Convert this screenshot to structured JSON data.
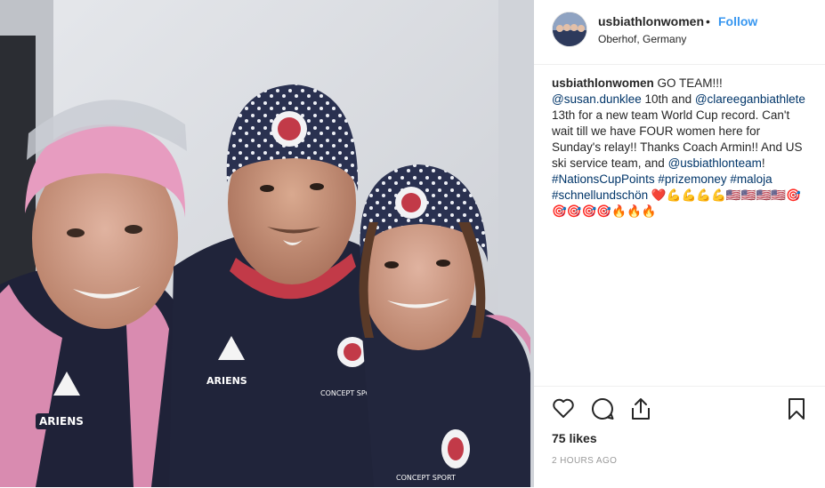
{
  "post": {
    "username": "usbiathlonwomen",
    "separator": "•",
    "follow_label": "Follow",
    "location": "Oberhof, Germany",
    "caption": {
      "username": "usbiathlonwomen",
      "parts": [
        {
          "type": "text",
          "value": " GO TEAM!!! "
        },
        {
          "type": "mention",
          "value": "@susan.dunklee"
        },
        {
          "type": "text",
          "value": " 10th and "
        },
        {
          "type": "mention",
          "value": "@clareeganbiathlete"
        },
        {
          "type": "text",
          "value": " 13th for a new team World Cup record. Can't wait till we have FOUR women here for Sunday's relay!! Thanks Coach Armin!! And US ski service team, and "
        },
        {
          "type": "mention",
          "value": "@usbiathlonteam"
        },
        {
          "type": "text",
          "value": "! "
        },
        {
          "type": "mention",
          "value": "#NationsCupPoints"
        },
        {
          "type": "text",
          "value": " "
        },
        {
          "type": "mention",
          "value": "#prizemoney"
        },
        {
          "type": "text",
          "value": " "
        },
        {
          "type": "mention",
          "value": "#maloja"
        },
        {
          "type": "text",
          "value": " "
        },
        {
          "type": "mention",
          "value": "#schnellundschön"
        },
        {
          "type": "text",
          "value": " ❤️💪💪💪💪🇺🇸🇺🇸🇺🇸🇺🇸🎯🎯🎯🎯🎯🔥🔥🔥"
        }
      ]
    },
    "likes": "75 likes",
    "time_ago": "2 HOURS AGO"
  },
  "icons": {
    "like": "heart-outline-icon",
    "comment": "comment-bubble-icon",
    "share": "share-arrow-icon",
    "save": "bookmark-icon"
  },
  "photo": {
    "jacket_brand": "ARIENS",
    "jacket_text": "CONCEPT SPORT",
    "hat_text": "ARIENS",
    "jacket_text_2": "ARIENS",
    "jacket_text_3": "ARIENS",
    "text_4": "CONCEPT SPORT"
  },
  "colors": {
    "link": "#003569",
    "follow": "#3897f0",
    "text": "#262626",
    "muted": "#999999"
  }
}
